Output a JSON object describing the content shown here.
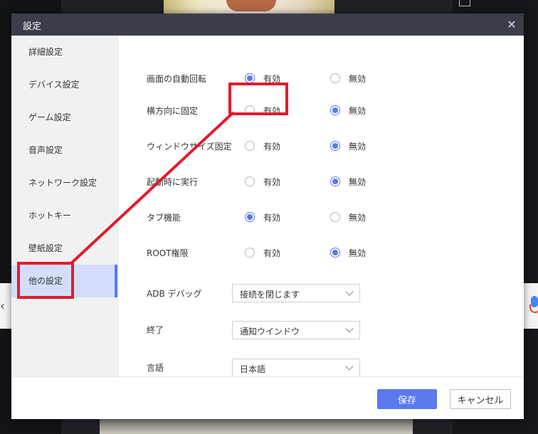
{
  "dialog": {
    "title": "設定",
    "close_icon": "close-icon"
  },
  "sidebar": {
    "items": [
      {
        "label": "詳細設定"
      },
      {
        "label": "デバイス設定"
      },
      {
        "label": "ゲーム設定"
      },
      {
        "label": "音声設定"
      },
      {
        "label": "ネットワーク設定"
      },
      {
        "label": "ホットキー"
      },
      {
        "label": "壁紙設定"
      },
      {
        "label": "他の設定",
        "active": true
      }
    ]
  },
  "settings": {
    "radio_rows": [
      {
        "label": "画面の自動回転",
        "on_label": "有効",
        "off_label": "無効",
        "selected": "on"
      },
      {
        "label": "横方向に固定",
        "on_label": "有効",
        "off_label": "無効",
        "selected": "off"
      },
      {
        "label": "ウィンドウサイズ固定",
        "on_label": "有効",
        "off_label": "無効",
        "selected": "off"
      },
      {
        "label": "起動時に実行",
        "on_label": "有効",
        "off_label": "無効",
        "selected": "off"
      },
      {
        "label": "タブ機能",
        "on_label": "有効",
        "off_label": "無効",
        "selected": "on"
      },
      {
        "label": "ROOT権限",
        "on_label": "有効",
        "off_label": "無効",
        "selected": "off"
      }
    ],
    "select_rows": [
      {
        "label": "ADB デバッグ",
        "value": "接続を閉じます"
      },
      {
        "label": "終了",
        "value": "通知ウインドウ"
      },
      {
        "label": "言語",
        "value": "日本語"
      }
    ]
  },
  "footer": {
    "save_label": "保存",
    "cancel_label": "キャンセル"
  },
  "colors": {
    "accent": "#5a79ec",
    "titlebar": "#3b3e4a",
    "annotation": "#e21b2c",
    "active_nav": "#d4defc"
  }
}
